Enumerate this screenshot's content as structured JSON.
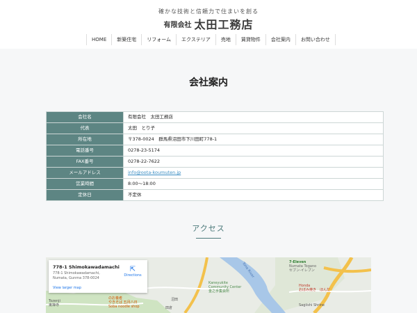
{
  "header": {
    "tagline": "確かな技術と信頼力で住まいを創る",
    "logo_small": "有限会社",
    "logo_big": "太田工務店"
  },
  "nav": {
    "items": [
      "HOME",
      "新築住宅",
      "リフォーム",
      "エクステリア",
      "売地",
      "賃貸物件",
      "会社案内",
      "お問い合わせ"
    ]
  },
  "page": {
    "title": "会社案内"
  },
  "company": {
    "rows": [
      {
        "label": "会社名",
        "value": "有限会社　太田工務店"
      },
      {
        "label": "代表",
        "value": "太田　とり子"
      },
      {
        "label": "所在地",
        "value": "〒378-0024　群馬県沼田市下川田町778-1"
      },
      {
        "label": "電話番号",
        "value": "0278-23-5174"
      },
      {
        "label": "FAX番号",
        "value": "0278-22-7622"
      },
      {
        "label": "メールアドレス",
        "value": "info@oota-koumuten.jp"
      },
      {
        "label": "営業時間",
        "value": "8:00～18:00"
      },
      {
        "label": "定休日",
        "value": "不定休"
      }
    ]
  },
  "access": {
    "title": "アクセス"
  },
  "map": {
    "card_title": "778-1 Shimokawadamachi",
    "card_address": "778-1 Shimokawadamachi, Numata, Gunma 378-0024",
    "view_larger": "View larger map",
    "directions": "Directions",
    "directions_icon": "directions-icon",
    "labels": {
      "eleven": "7-Eleven",
      "eleven_sub": "Numata Togano",
      "eleven_jp": "セブン-イレブン",
      "tone_river": "Tone River",
      "community": "Kaneyukite",
      "community2": "Community Center",
      "community_jp": "金之手集会所",
      "honda": "Honda",
      "honda_jp": "おぼみ焼き　ほんだ",
      "sagiishi": "Sagiishi Shrine",
      "soba_jp": "やきそば 五月八日",
      "soba": "Soba noodle shop",
      "otoriya": "のお養者",
      "tozenji": "Tozenji",
      "tozenji_jp": "東禅寺",
      "kanji1": "沼田",
      "kanji2": "田倉"
    },
    "colors": {
      "water": "#a8c7e8",
      "road": "#f3c14c",
      "park": "#cfe4c2",
      "land": "#e9ece6"
    }
  }
}
